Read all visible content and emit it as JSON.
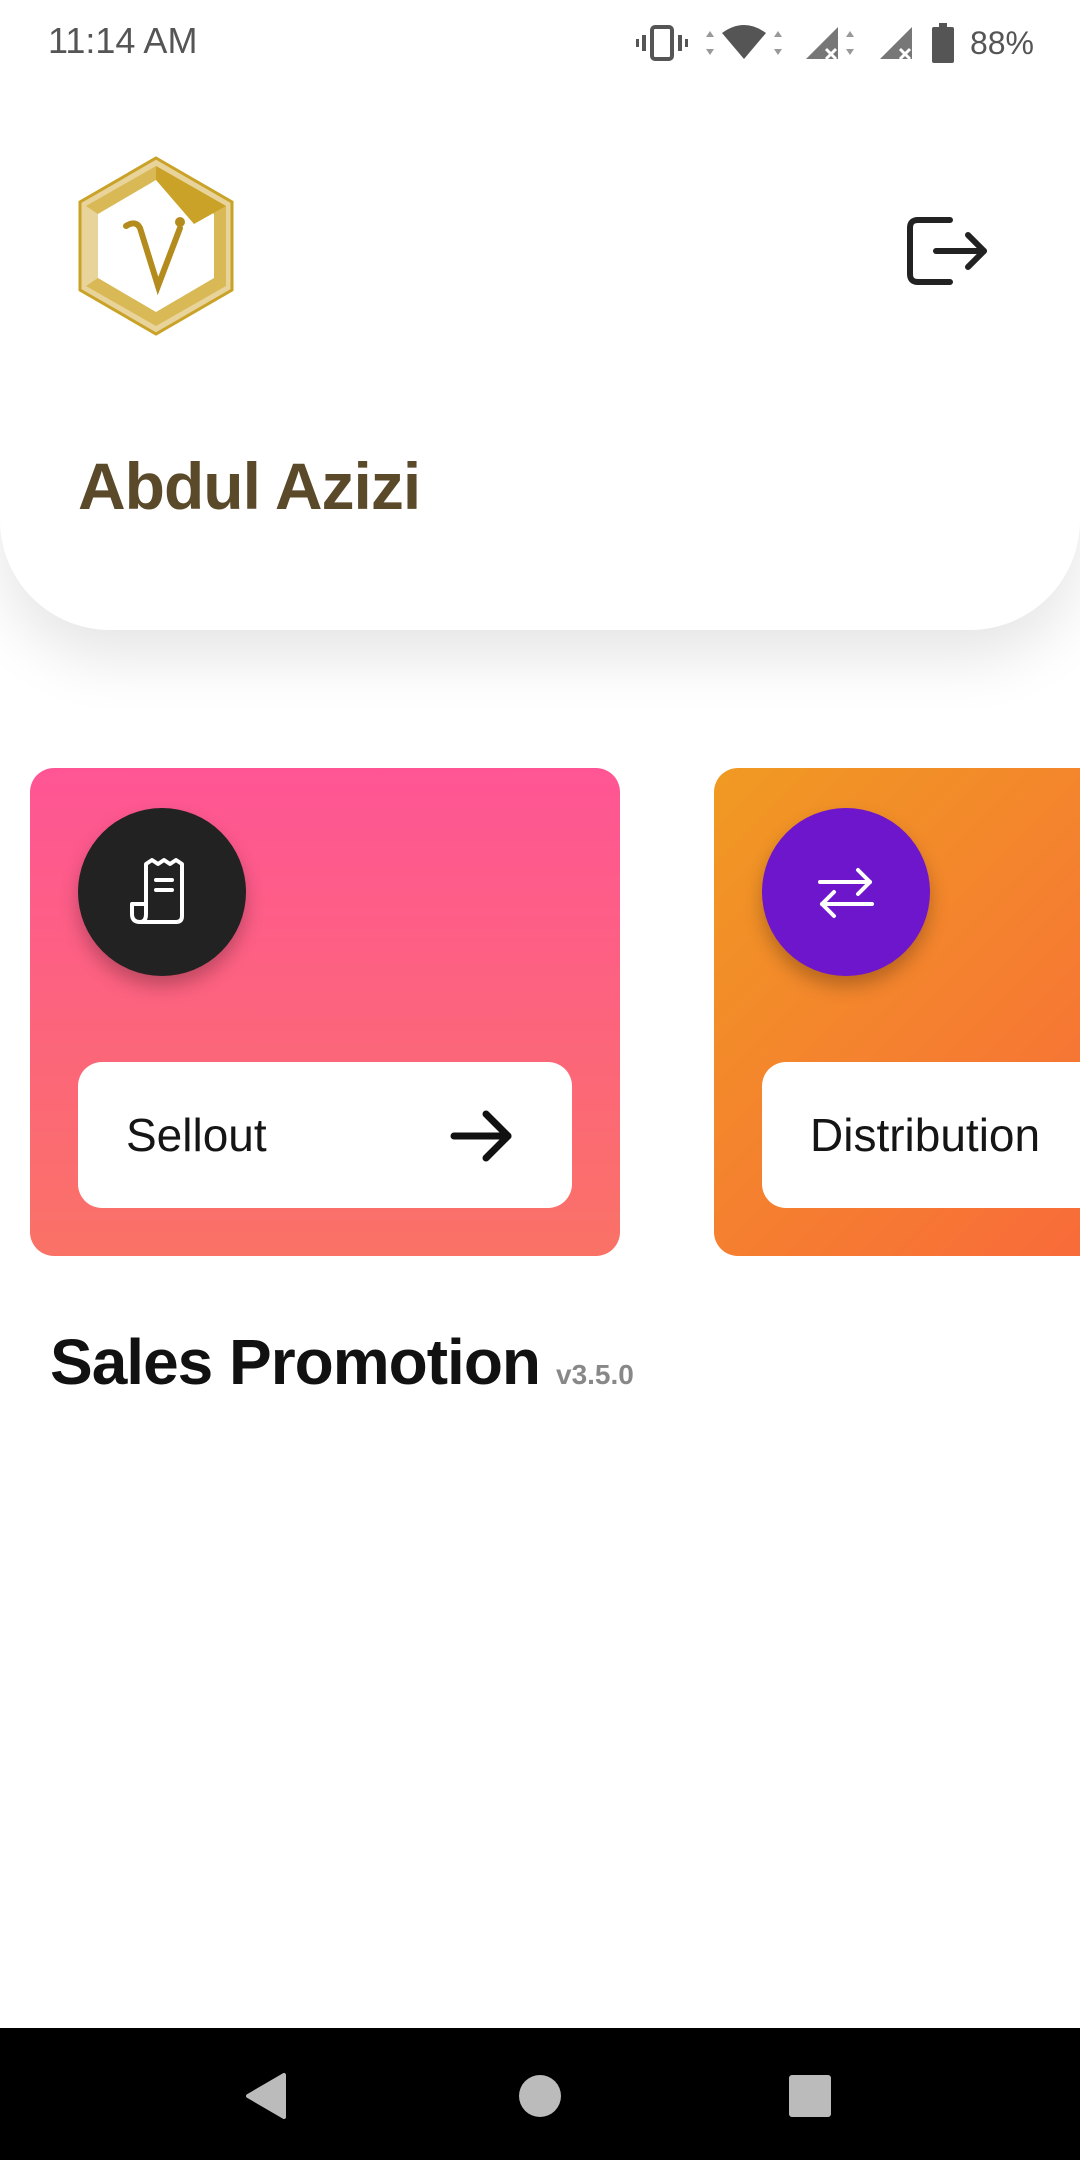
{
  "status_bar": {
    "time": "11:14 AM",
    "battery": "88%"
  },
  "header": {
    "user_name": "Abdul Azizi"
  },
  "menu": {
    "items": [
      {
        "label": "Sellout",
        "icon": "receipt-icon"
      },
      {
        "label": "Distribution",
        "icon": "swap-arrows-icon"
      }
    ]
  },
  "app": {
    "title": "Sales Promotion",
    "version": "v3.5.0"
  },
  "colors": {
    "sellout_gradient": [
      "#ff5595",
      "#fa7266"
    ],
    "distribution_gradient": [
      "#f09a22",
      "#f9683b"
    ],
    "sellout_icon_bg": "#222222",
    "distribution_icon_bg": "#6d16cc",
    "user_name": "#5a4a2a",
    "logo_gold": "#c9a227"
  }
}
